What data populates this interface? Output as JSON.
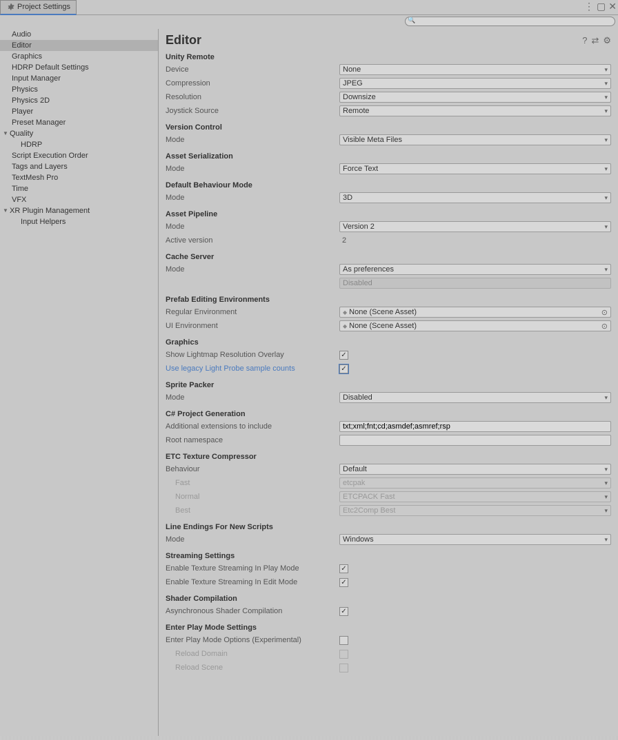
{
  "window": {
    "title": "Project Settings"
  },
  "sidebar": {
    "items": [
      {
        "label": "Audio",
        "selected": false
      },
      {
        "label": "Editor",
        "selected": true
      },
      {
        "label": "Graphics",
        "selected": false
      },
      {
        "label": "HDRP Default Settings",
        "selected": false
      },
      {
        "label": "Input Manager",
        "selected": false
      },
      {
        "label": "Physics",
        "selected": false
      },
      {
        "label": "Physics 2D",
        "selected": false
      },
      {
        "label": "Player",
        "selected": false
      },
      {
        "label": "Preset Manager",
        "selected": false
      },
      {
        "label": "Quality",
        "expandable": true,
        "expanded": true
      },
      {
        "label": "HDRP",
        "child": true
      },
      {
        "label": "Script Execution Order",
        "selected": false
      },
      {
        "label": "Tags and Layers",
        "selected": false
      },
      {
        "label": "TextMesh Pro",
        "selected": false
      },
      {
        "label": "Time",
        "selected": false
      },
      {
        "label": "VFX",
        "selected": false
      },
      {
        "label": "XR Plugin Management",
        "expandable": true,
        "expanded": true
      },
      {
        "label": "Input Helpers",
        "child": true
      }
    ]
  },
  "content": {
    "title": "Editor",
    "sections": {
      "unity_remote": {
        "header": "Unity Remote",
        "device": {
          "label": "Device",
          "value": "None"
        },
        "compression": {
          "label": "Compression",
          "value": "JPEG"
        },
        "resolution": {
          "label": "Resolution",
          "value": "Downsize"
        },
        "joystick_source": {
          "label": "Joystick Source",
          "value": "Remote"
        }
      },
      "version_control": {
        "header": "Version Control",
        "mode": {
          "label": "Mode",
          "value": "Visible Meta Files"
        }
      },
      "asset_serialization": {
        "header": "Asset Serialization",
        "mode": {
          "label": "Mode",
          "value": "Force Text"
        }
      },
      "default_behaviour_mode": {
        "header": "Default Behaviour Mode",
        "mode": {
          "label": "Mode",
          "value": "3D"
        }
      },
      "asset_pipeline": {
        "header": "Asset Pipeline",
        "mode": {
          "label": "Mode",
          "value": "Version 2"
        },
        "active_version": {
          "label": "Active version",
          "value": "2"
        }
      },
      "cache_server": {
        "header": "Cache Server",
        "mode": {
          "label": "Mode",
          "value": "As preferences"
        },
        "status": "Disabled"
      },
      "prefab_editing": {
        "header": "Prefab Editing Environments",
        "regular": {
          "label": "Regular Environment",
          "value": "None (Scene Asset)"
        },
        "ui": {
          "label": "UI Environment",
          "value": "None (Scene Asset)"
        }
      },
      "graphics": {
        "header": "Graphics",
        "lightmap": {
          "label": "Show Lightmap Resolution Overlay",
          "checked": true
        },
        "lightprobe": {
          "label": "Use legacy Light Probe sample counts",
          "checked": true
        }
      },
      "sprite_packer": {
        "header": "Sprite Packer",
        "mode": {
          "label": "Mode",
          "value": "Disabled"
        }
      },
      "csharp_gen": {
        "header": "C# Project Generation",
        "extensions": {
          "label": "Additional extensions to include",
          "value": "txt;xml;fnt;cd;asmdef;asmref;rsp"
        },
        "root_ns": {
          "label": "Root namespace",
          "value": ""
        }
      },
      "etc": {
        "header": "ETC Texture Compressor",
        "behaviour": {
          "label": "Behaviour",
          "value": "Default"
        },
        "fast": {
          "label": "Fast",
          "value": "etcpak"
        },
        "normal": {
          "label": "Normal",
          "value": "ETCPACK Fast"
        },
        "best": {
          "label": "Best",
          "value": "Etc2Comp Best"
        }
      },
      "line_endings": {
        "header": "Line Endings For New Scripts",
        "mode": {
          "label": "Mode",
          "value": "Windows"
        }
      },
      "streaming": {
        "header": "Streaming Settings",
        "play": {
          "label": "Enable Texture Streaming In Play Mode",
          "checked": true
        },
        "edit": {
          "label": "Enable Texture Streaming In Edit Mode",
          "checked": true
        }
      },
      "shader": {
        "header": "Shader Compilation",
        "async": {
          "label": "Asynchronous Shader Compilation",
          "checked": true
        }
      },
      "play_mode": {
        "header": "Enter Play Mode Settings",
        "options": {
          "label": "Enter Play Mode Options (Experimental)",
          "checked": false
        },
        "reload_domain": {
          "label": "Reload Domain",
          "checked": false
        },
        "reload_scene": {
          "label": "Reload Scene",
          "checked": false
        }
      }
    }
  }
}
